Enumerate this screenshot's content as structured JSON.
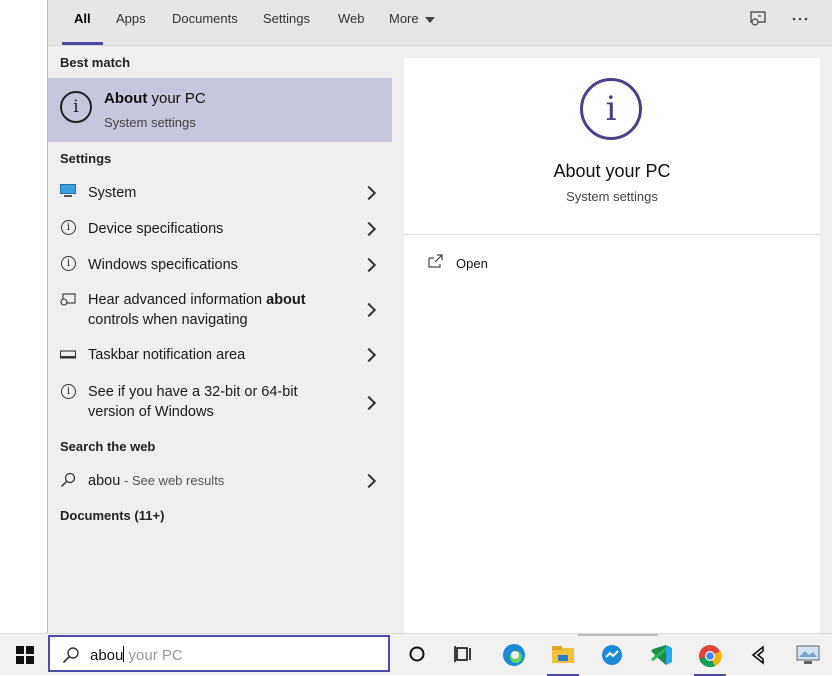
{
  "tabs": [
    {
      "label": "All"
    },
    {
      "label": "Apps"
    },
    {
      "label": "Documents"
    },
    {
      "label": "Settings"
    },
    {
      "label": "Web"
    },
    {
      "label": "More"
    }
  ],
  "header_icons": {
    "feedback": "feedback-icon",
    "options": "ellipsis-icon"
  },
  "sections": {
    "best_match": "Best match",
    "settings": "Settings",
    "search_web": "Search the web",
    "documents": "Documents (11+)"
  },
  "best_match": {
    "title_bold": "About",
    "title_rest": " your PC",
    "subtitle": "System settings",
    "icon": "info-icon"
  },
  "settings_items": [
    {
      "line1": "System",
      "line2": "",
      "icon": "monitor-icon"
    },
    {
      "line1": "Device specifications",
      "line2": "",
      "icon": "info-icon"
    },
    {
      "line1": "Windows specifications",
      "line2": "",
      "icon": "info-icon"
    },
    {
      "line1_pre": "Hear advanced information ",
      "line1_bold": "about",
      "line2": "controls when navigating",
      "icon": "narrator-icon"
    },
    {
      "line1": "Taskbar notification area",
      "line2": "",
      "icon": "taskbar-icon"
    },
    {
      "line1": "See if you have a 32-bit or 64-bit",
      "line2": "version of Windows",
      "icon": "info-icon"
    }
  ],
  "web_item": {
    "query": "abou",
    "hint": " - See web results",
    "icon": "search-icon"
  },
  "preview": {
    "title": "About your PC",
    "subtitle": "System settings",
    "action": "Open"
  },
  "search": {
    "typed": "abou",
    "ghost": " your PC"
  },
  "taskbar_icons": [
    "windows-start-icon",
    "cortana-icon",
    "task-view-icon",
    "edge-icon",
    "file-explorer-icon",
    "app-icon",
    "vscode-icon",
    "chrome-icon",
    "dev-app-icon",
    "remote-desktop-icon"
  ],
  "colors": {
    "accent": "#4c4ca0",
    "selection": "#c6c6dd",
    "preview_icon": "#4c3f86"
  }
}
